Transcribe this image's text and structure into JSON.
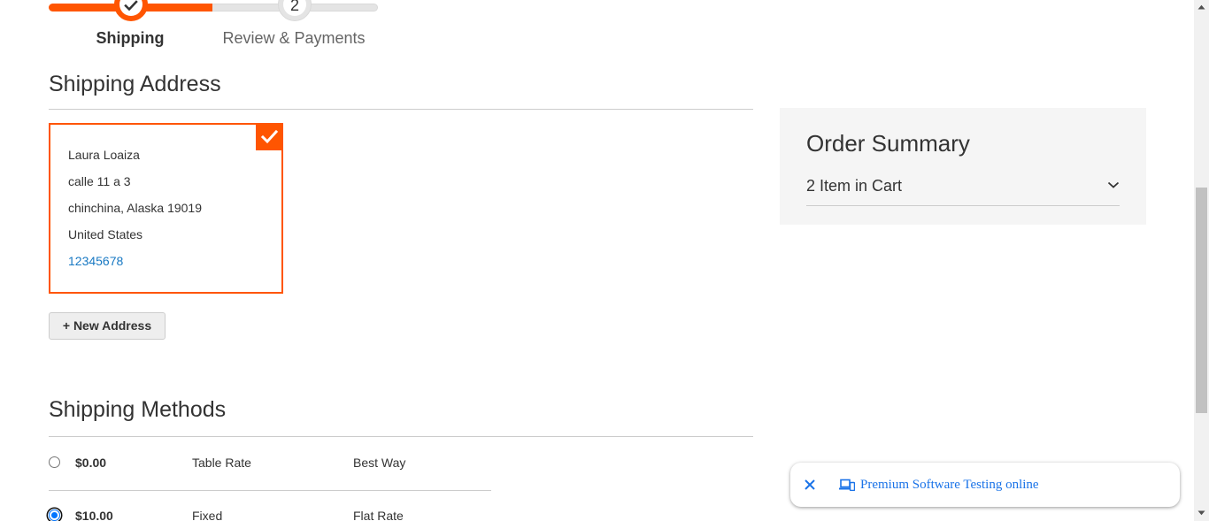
{
  "colors": {
    "accent": "#ff5501",
    "link": "#1979c3",
    "text": "#333333",
    "summary_bg": "#f5f5f5",
    "notice_link": "#1a73e8"
  },
  "progress": {
    "steps": [
      {
        "label": "Shipping",
        "state": "active",
        "icon": "check-icon"
      },
      {
        "label": "Review & Payments",
        "number": "2",
        "state": "pending"
      }
    ]
  },
  "shipping_address": {
    "title": "Shipping Address",
    "selected_address": {
      "name": "Laura Loaiza",
      "street": "calle 11 a 3",
      "city_region_postcode": "chinchina, Alaska 19019",
      "country": "United States",
      "telephone": "12345678",
      "selected_icon": "check-icon"
    },
    "new_address_button": "+ New Address"
  },
  "shipping_methods": {
    "title": "Shipping Methods",
    "rows": [
      {
        "price": "$0.00",
        "method": "Table Rate",
        "carrier": "Best Way",
        "selected": false
      },
      {
        "price": "$10.00",
        "method": "Fixed",
        "carrier": "Flat Rate",
        "selected": true
      }
    ]
  },
  "order_summary": {
    "title": "Order Summary",
    "items_in_cart": "2 Item in Cart",
    "toggle_icon": "chevron-down-icon"
  },
  "notification": {
    "close_icon": "close-icon",
    "device_icon": "devices-icon",
    "text": "Premium Software Testing online"
  },
  "scrollbar": {
    "up_icon": "scroll-up-arrow-icon",
    "down_icon": "scroll-down-arrow-icon"
  }
}
